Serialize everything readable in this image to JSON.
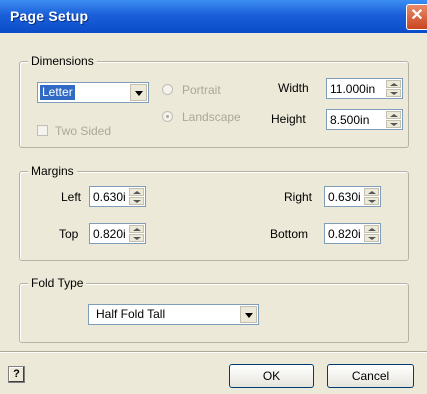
{
  "window": {
    "title": "Page Setup",
    "close_label": "✕"
  },
  "dimensions": {
    "legend": "Dimensions",
    "paper_size": "Letter",
    "portrait_label": "Portrait",
    "landscape_label": "Landscape",
    "orientation_selected": "Landscape",
    "two_sided_label": "Two Sided",
    "width_label": "Width",
    "width_value": "11.000in",
    "height_label": "Height",
    "height_value": "8.500in"
  },
  "margins": {
    "legend": "Margins",
    "left_label": "Left",
    "left_value": "0.630i",
    "top_label": "Top",
    "top_value": "0.820i",
    "right_label": "Right",
    "right_value": "0.630i",
    "bottom_label": "Bottom",
    "bottom_value": "0.820i"
  },
  "fold": {
    "legend": "Fold Type",
    "value": "Half Fold Tall"
  },
  "buttons": {
    "help_label": "?",
    "ok_label": "OK",
    "cancel_label": "Cancel"
  }
}
